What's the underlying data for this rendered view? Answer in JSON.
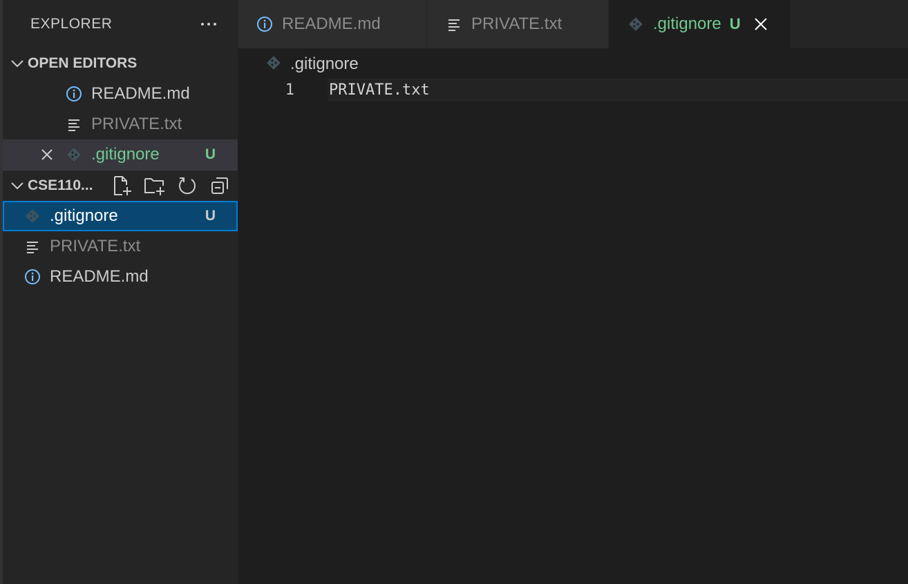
{
  "sidebar": {
    "title": "EXPLORER",
    "open_editors": {
      "label": "OPEN EDITORS",
      "items": [
        {
          "label": "README.md",
          "icon": "info-icon",
          "color": "#cccccc"
        },
        {
          "label": "PRIVATE.txt",
          "icon": "lines-icon",
          "color": "#8c8c8c"
        },
        {
          "label": ".gitignore",
          "icon": "git-icon",
          "color": "#73c991",
          "badge": "U"
        }
      ]
    },
    "folder": {
      "label": "CSE110...",
      "items": [
        {
          "label": ".gitignore",
          "icon": "git-icon",
          "color": "#ffffff",
          "badge": "U"
        },
        {
          "label": "PRIVATE.txt",
          "icon": "lines-icon",
          "color": "#8c8c8c"
        },
        {
          "label": "README.md",
          "icon": "info-icon",
          "color": "#cccccc"
        }
      ]
    }
  },
  "tabs": [
    {
      "label": "README.md",
      "icon": "info-icon",
      "active": false
    },
    {
      "label": "PRIVATE.txt",
      "icon": "lines-icon",
      "active": false
    },
    {
      "label": ".gitignore",
      "icon": "git-icon",
      "active": true,
      "badge": "U"
    }
  ],
  "editor": {
    "breadcrumb": ".gitignore",
    "lines": [
      {
        "number": "1",
        "text": "PRIVATE.txt"
      }
    ]
  },
  "colors": {
    "accent": "#007fd4",
    "untracked": "#73c991",
    "info_icon": "#75beff"
  }
}
